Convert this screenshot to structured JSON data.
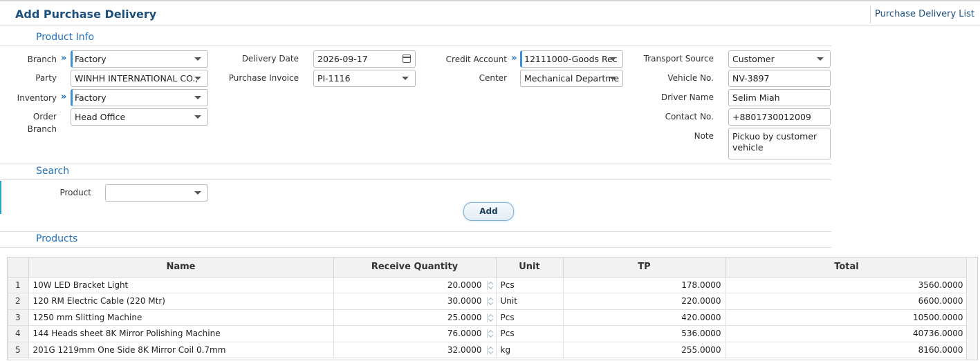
{
  "header": {
    "title": "Add Purchase Delivery",
    "list_link": "Purchase Delivery List"
  },
  "sections": {
    "product_info": "Product Info",
    "search": "Search",
    "products": "Products"
  },
  "form": {
    "branch": {
      "label": "Branch",
      "value": "Factory"
    },
    "party": {
      "label": "Party",
      "value": "WINHH INTERNATIONAL CO.,"
    },
    "inventory": {
      "label": "Inventory",
      "value": "Factory"
    },
    "order_branch": {
      "label_line1": "Order",
      "label_line2": "Branch",
      "value": "Head Office"
    },
    "delivery_date": {
      "label": "Delivery Date",
      "value": "2026-09-17"
    },
    "purchase_invoice": {
      "label": "Purchase Invoice",
      "value": "PI-1116"
    },
    "credit_account": {
      "label": "Credit Account",
      "value": "12111000-Goods Rec"
    },
    "center": {
      "label": "Center",
      "value": "Mechanical Departme"
    },
    "transport_source": {
      "label": "Transport Source",
      "value": "Customer"
    },
    "vehicle_no": {
      "label": "Vehicle No.",
      "value": "NV-3897"
    },
    "driver_name": {
      "label": "Driver Name",
      "value": "Selim Miah"
    },
    "contact_no": {
      "label": "Contact No.",
      "value": "+8801730012009"
    },
    "note": {
      "label": "Note",
      "value": "Pickuo by customer vehicle"
    }
  },
  "search": {
    "product_label": "Product",
    "product_value": "",
    "add_button": "Add"
  },
  "table": {
    "columns": [
      "Name",
      "Receive Quantity",
      "Unit",
      "TP",
      "Total"
    ],
    "rows": [
      {
        "idx": "1",
        "name": "10W LED Bracket Light",
        "qty": "20.0000",
        "unit": "Pcs",
        "tp": "178.0000",
        "total": "3560.0000"
      },
      {
        "idx": "2",
        "name": "120 RM Electric Cable (220 Mtr)",
        "qty": "30.0000",
        "unit": "Unit",
        "tp": "220.0000",
        "total": "6600.0000"
      },
      {
        "idx": "3",
        "name": "1250 mm Slitting Machine",
        "qty": "25.0000",
        "unit": "Pcs",
        "tp": "420.0000",
        "total": "10500.0000"
      },
      {
        "idx": "4",
        "name": "144 Heads sheet 8K Mirror Polishing Machine",
        "qty": "76.0000",
        "unit": "Pcs",
        "tp": "536.0000",
        "total": "40736.0000"
      },
      {
        "idx": "5",
        "name": "201G 1219mm One Side 8K Mirror Coil 0.7mm",
        "qty": "32.0000",
        "unit": "kg",
        "tp": "255.0000",
        "total": "8160.0000"
      }
    ]
  },
  "icons": {
    "required_marker": "double-chevron-right-icon",
    "dropdown": "caret-down-icon",
    "date": "calendar-icon",
    "spinner": "up-down-spinner-icon"
  },
  "colors": {
    "title": "#1d4f7c",
    "section": "#1f6fb8",
    "required_border": "#3a8fd8"
  }
}
